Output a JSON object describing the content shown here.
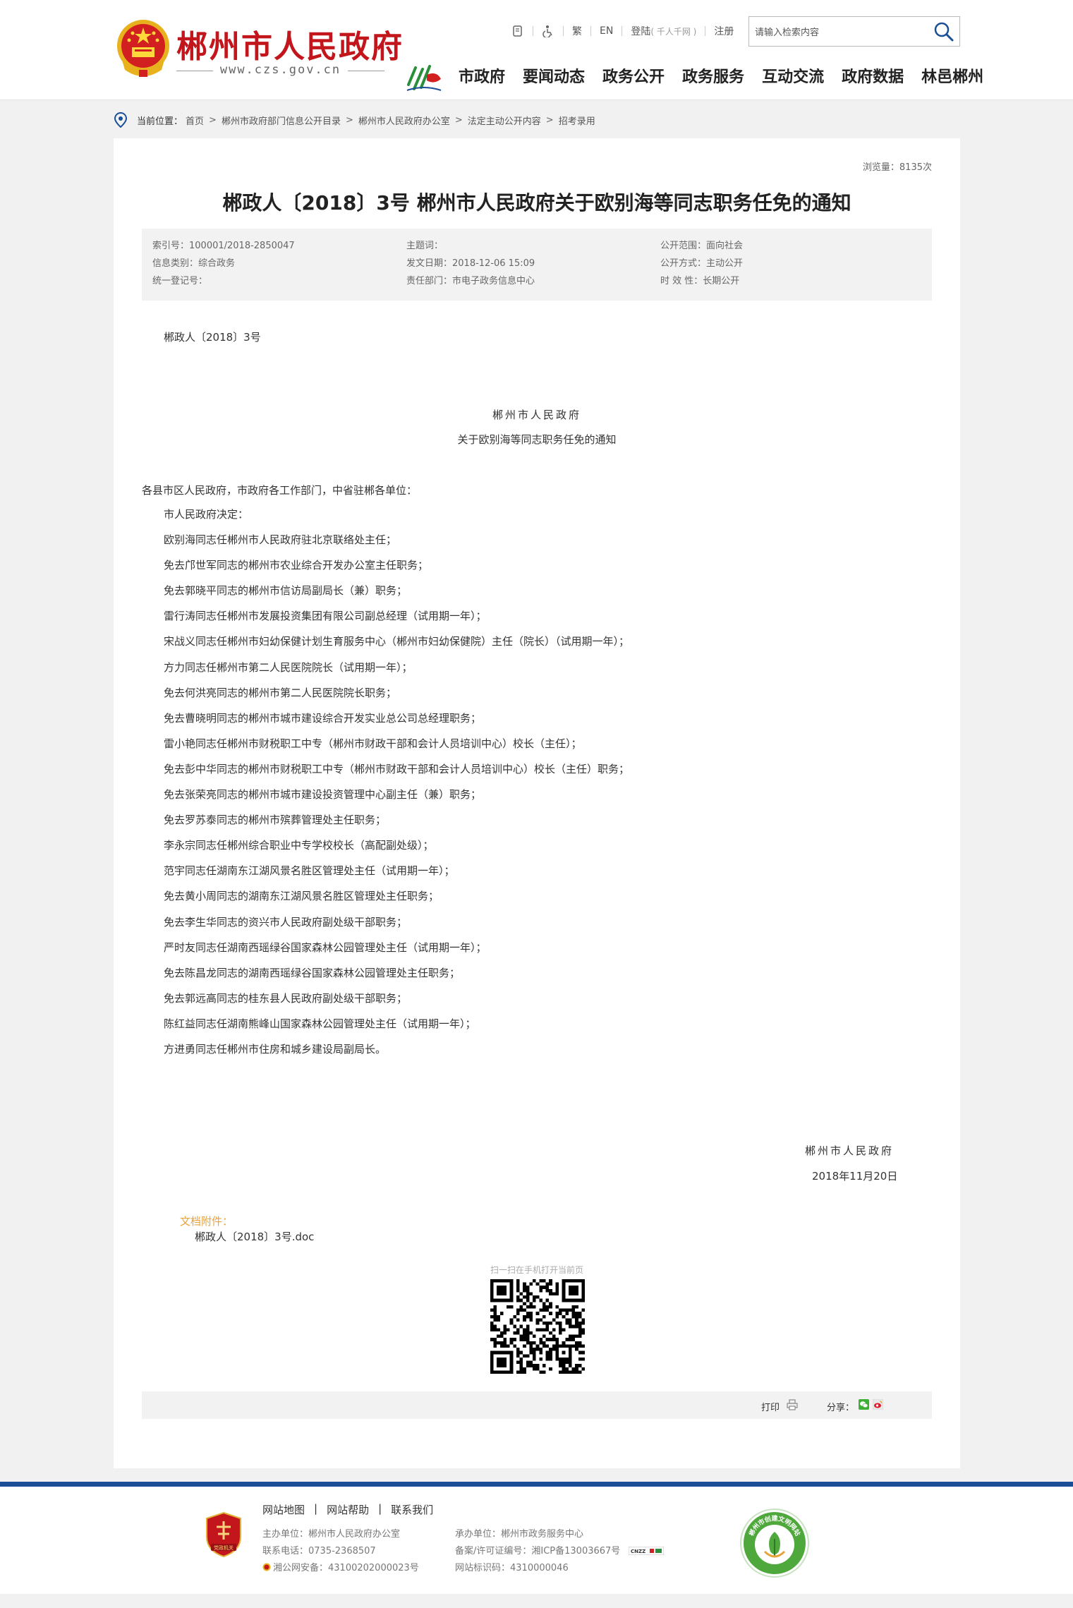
{
  "site": {
    "name": "郴州市人民政府",
    "url": "www.czs.gov.cn"
  },
  "toplinks": {
    "barrier_free_icon": "accessibility-icon",
    "traditional": "繁",
    "english": "EN",
    "login": "登陆",
    "login_note": "( 千人千网 )",
    "register": "注册"
  },
  "search": {
    "placeholder": "请输入检索内容"
  },
  "nav": [
    "市政府",
    "要闻动态",
    "政务公开",
    "政务服务",
    "互动交流",
    "政府数据",
    "林邑郴州"
  ],
  "breadcrumb": {
    "label": "当前位置：",
    "items": [
      "首页",
      "郴州市政府部门信息公开目录",
      "郴州市人民政府办公室",
      "法定主动公开内容",
      "招考录用"
    ]
  },
  "article": {
    "views": "浏览量：8135次",
    "title": "郴政人〔2018〕3号 郴州市人民政府关于欧别海等同志职务任免的通知",
    "meta": {
      "index_no": "索引号：100001/2018-2850047",
      "category": "信息类别：综合政务",
      "reg_no": "统一登记号：",
      "subject": "主题词：",
      "issue_date": "发文日期：2018-12-06 15:09",
      "dept": "责任部门：市电子政务信息中心",
      "scope": "公开范围：面向社会",
      "mode": "公开方式：主动公开",
      "validity": "时 效 性：长期公开"
    },
    "doc_no": "郴政人〔2018〕3号",
    "org_heading": "郴州市人民政府",
    "sub_heading": "关于欧别海等同志职务任免的通知",
    "addressee": "各县市区人民政府，市政府各工作部门，中省驻郴各单位：",
    "lines": [
      "市人民政府决定：",
      "欧别海同志任郴州市人民政府驻北京联络处主任；",
      "免去邝世军同志的郴州市农业综合开发办公室主任职务；",
      "免去郭晓平同志的郴州市信访局副局长（兼）职务；",
      "雷行涛同志任郴州市发展投资集团有限公司副总经理（试用期一年）；",
      "宋战义同志任郴州市妇幼保健计划生育服务中心（郴州市妇幼保健院）主任（院长）（试用期一年）；",
      "方力同志任郴州市第二人民医院院长（试用期一年）；",
      "免去何洪亮同志的郴州市第二人民医院院长职务；",
      "免去曹晓明同志的郴州市城市建设综合开发实业总公司总经理职务；",
      "雷小艳同志任郴州市财税职工中专（郴州市财政干部和会计人员培训中心）校长（主任）；",
      "免去彭中华同志的郴州市财税职工中专（郴州市财政干部和会计人员培训中心）校长（主任）职务；",
      "免去张荣亮同志的郴州市城市建设投资管理中心副主任（兼）职务；",
      "免去罗苏泰同志的郴州市殡葬管理处主任职务；",
      "李永宗同志任郴州综合职业中专学校校长（高配副处级）；",
      "范宇同志任湖南东江湖风景名胜区管理处主任（试用期一年）；",
      "免去黄小周同志的湖南东江湖风景名胜区管理处主任职务；",
      "免去李生华同志的资兴市人民政府副处级干部职务；",
      "严时友同志任湖南西瑶绿谷国家森林公园管理处主任（试用期一年）；",
      "免去陈昌龙同志的湖南西瑶绿谷国家森林公园管理处主任职务；",
      "免去郭远高同志的桂东县人民政府副处级干部职务；",
      "陈红益同志任湖南熊峰山国家森林公园管理处主任（试用期一年）；",
      "方进勇同志任郴州市住房和城乡建设局副局长。"
    ],
    "sign_org": "郴州市人民政府",
    "sign_date": "2018年11月20日",
    "attachment_label": "文档附件：",
    "attachment_file": "郴政人〔2018〕3号.doc",
    "scan_text": "扫一扫在手机打开当前页",
    "print_label": "打印",
    "share_label": "分享："
  },
  "footer": {
    "links": [
      "网站地图",
      "网站帮助",
      "联系我们"
    ],
    "sponsor": "主办单位：郴州市人民政府办公室",
    "phone": "联系电话：0735-2368507",
    "police": "湘公网安备：43100202000023号",
    "undertaker": "承办单位：郴州市政务服务中心",
    "icp": "备案/许可证编号：湘ICP备13003667号",
    "site_code": "网站标识码：4310000046",
    "cnzz": "CNZZ",
    "party_badge": "党政机关",
    "civic_badge": "郴州市创建文明网站"
  },
  "colors": {
    "brand_red": "#c3161c",
    "footer_blue": "#1a4e96",
    "attach_orange": "#e8a23a"
  }
}
